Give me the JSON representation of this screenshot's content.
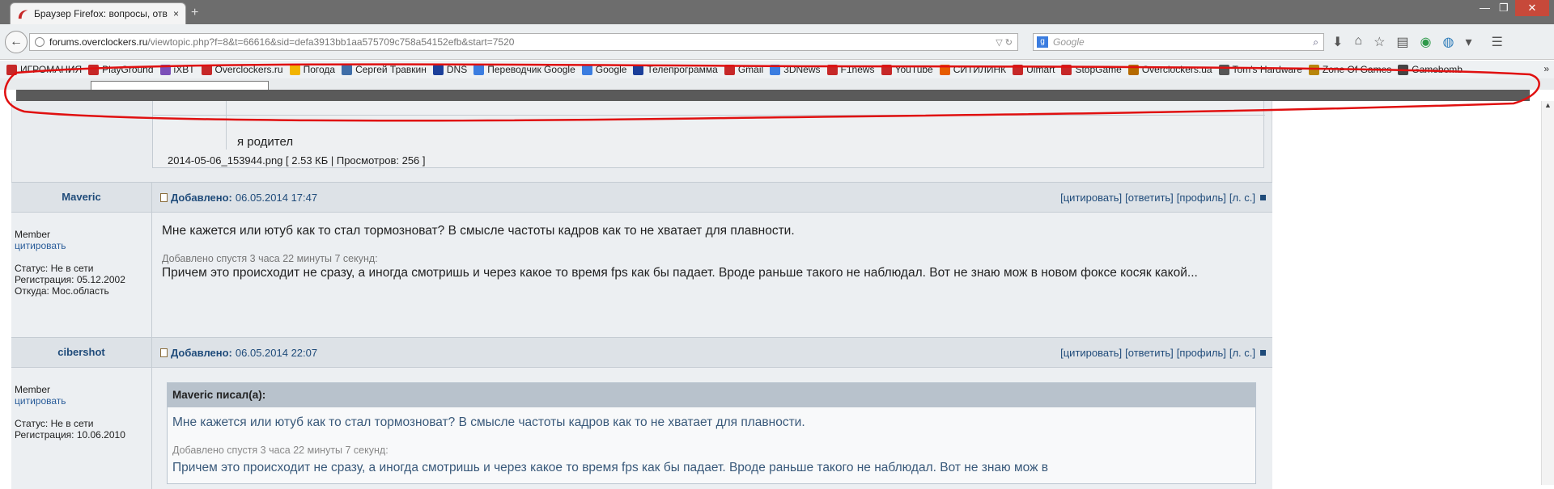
{
  "browser": {
    "tab_title": "Браузер Firefox: вопросы, отв...",
    "tab_close": "×",
    "new_tab": "+",
    "url_host": "forums.overclockers.ru",
    "url_rest": "/viewtopic.php?f=8&t=66616&sid=defa3913bb1aa575709c758a54152efb&start=7520",
    "search_placeholder": "Google",
    "window_controls": [
      "—",
      "❐",
      "✕"
    ]
  },
  "bookmarks": [
    {
      "label": "ИГРОМАНИЯ",
      "color": "#c62828"
    },
    {
      "label": "PlayGround",
      "color": "#c62828"
    },
    {
      "label": "iXBT",
      "color": "#7b4fb8"
    },
    {
      "label": "Overclockers.ru",
      "color": "#c62828"
    },
    {
      "label": "Погода",
      "color": "#f2b400"
    },
    {
      "label": "Сергей Травкин",
      "color": "#3f6ea8"
    },
    {
      "label": "DNS",
      "color": "#1b3f9a"
    },
    {
      "label": "Переводчик Google",
      "color": "#3b7de0"
    },
    {
      "label": "Google",
      "color": "#3b7de0"
    },
    {
      "label": "Телепрограмма",
      "color": "#1b3f9a"
    },
    {
      "label": "Gmail",
      "color": "#c62828"
    },
    {
      "label": "3DNews",
      "color": "#3b7de0"
    },
    {
      "label": "F1news",
      "color": "#c62828"
    },
    {
      "label": "YouTube",
      "color": "#c62828"
    },
    {
      "label": "СИТИЛИНК",
      "color": "#e65c00"
    },
    {
      "label": "Ulmart",
      "color": "#c62828"
    },
    {
      "label": "StopGame",
      "color": "#c62828"
    },
    {
      "label": "Overclockers.ua",
      "color": "#b56a00"
    },
    {
      "label": "Tom's Hardware",
      "color": "#555555"
    },
    {
      "label": "Zone Of Games",
      "color": "#b8860b"
    },
    {
      "label": "Gamebomb",
      "color": "#444444"
    }
  ],
  "bookmarks_more": "»",
  "attachment": {
    "caption": "я родител",
    "filename": "2014-05-06_153944.png [ 2.53 КБ | Просмотров: 256 ]"
  },
  "actions": {
    "quote": "[цитировать]",
    "reply": "[ответить]",
    "profile": "[профиль]",
    "pm": "[л. с.]"
  },
  "posts": [
    {
      "author": "Maveric",
      "added_label": "Добавлено:",
      "date": "06.05.2014 17:47",
      "rank": "Member",
      "quote_link": "цитировать",
      "status": "Статус: Не в сети",
      "registered": "Регистрация: 05.12.2002",
      "from": "Откуда: Мос.область",
      "message": "Мне кажется или ютуб как то стал тормозноват? В смысле частоты кадров как то не хватает для плавности.",
      "edited": "Добавлено спустя 3 часа 22 минуты 7 секунд:",
      "message2": "Причем это происходит не сразу, а иногда смотришь и через какое то время fps как бы падает. Вроде раньше такого не наблюдал. Вот не знаю мож в новом фоксе косяк какой..."
    },
    {
      "author": "cibershot",
      "added_label": "Добавлено:",
      "date": "06.05.2014 22:07",
      "rank": "Member",
      "quote_link": "цитировать",
      "status": "Статус: Не в сети",
      "registered": "Регистрация: 10.06.2010",
      "quote_header": "Maveric писал(а):",
      "quote_text": "Мне кажется или ютуб как то стал тормозноват? В смысле частоты кадров как то не хватает для плавности.",
      "quote_edited": "Добавлено спустя 3 часа 22 минуты 7 секунд:",
      "quote_text2": "Причем это происходит не сразу, а иногда смотришь и через какое то время fps как бы падает. Вроде раньше такого не наблюдал. Вот не знаю мож в"
    }
  ]
}
